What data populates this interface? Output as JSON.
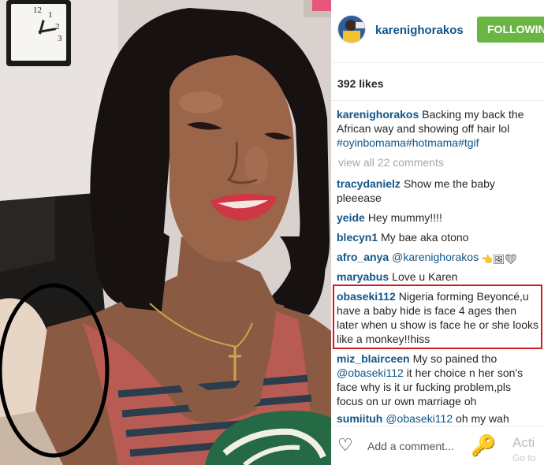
{
  "post": {
    "username": "karenighorakos",
    "follow_label": "FOLLOWING",
    "likes": "392 likes",
    "caption_text": "Backing my back the African way and showing off hair lol",
    "caption_tags": "#oyinbomama#hotmama#tgif",
    "view_all": "view all 22 comments"
  },
  "comments": [
    {
      "user": "tracydanielz",
      "text": "Show me the baby pleeease"
    },
    {
      "user": "yeide",
      "text": "Hey mummy!!!!"
    },
    {
      "user": "blecyn1",
      "text": "My bae aka otono"
    },
    {
      "user": "afro_anya",
      "mention": "@karenighorakos",
      "emoji": "👈🖼❤"
    },
    {
      "user": "maryabus",
      "text": "Love u Karen"
    },
    {
      "user": "obaseki112",
      "text": "Nigeria forming Beyoncé,u have a baby hide is face 4 ages then later when u show is face he or she looks like a monkey!!hiss"
    },
    {
      "user": "miz_blairceen",
      "text_a": "My so pained tho",
      "mention": "@obaseki112",
      "text_b": "it her choice n her son's face why is it ur fucking problem,pls focus on ur own marriage oh"
    },
    {
      "user": "sumiituh",
      "mention": "@obaseki112",
      "text": "oh my wah"
    }
  ],
  "footer": {
    "add_comment": "Add a comment...",
    "activate_title": "Acti",
    "activate_sub": "Go to"
  },
  "colors": {
    "link": "#125688",
    "follow": "#6bb643",
    "highlight": "#d4191e"
  },
  "icons": [
    "clock",
    "heart-outline-icon",
    "key-icon"
  ],
  "clock": {
    "numerals": [
      "12",
      "1",
      "2",
      "3"
    ]
  }
}
